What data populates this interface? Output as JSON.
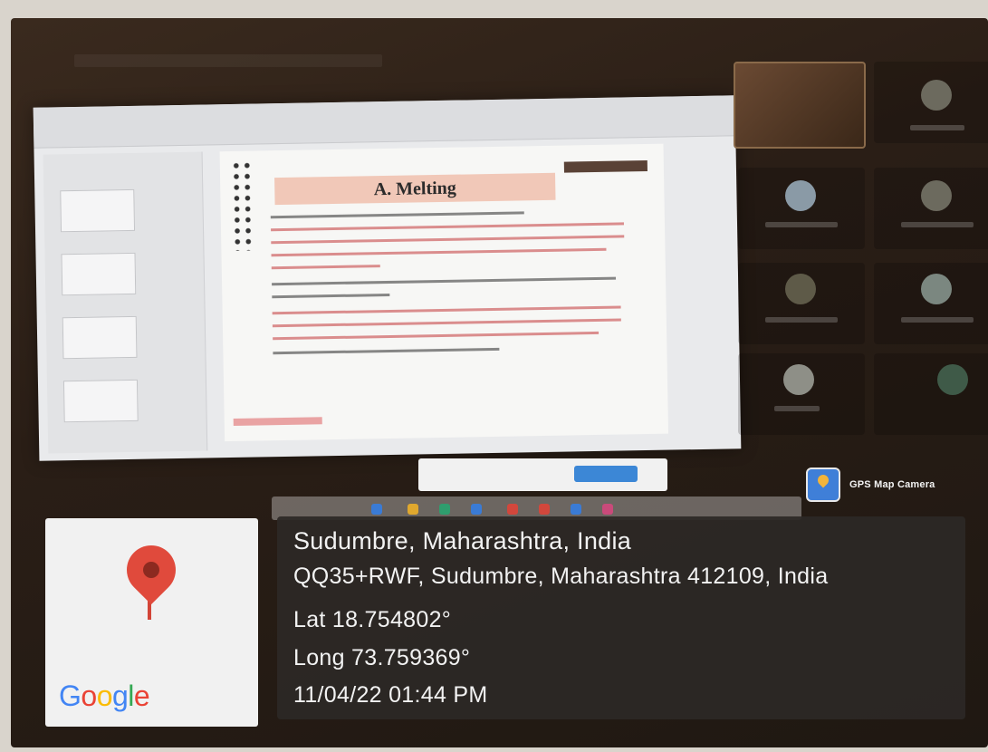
{
  "overlay": {
    "app_name": "GPS Map Camera",
    "location_title": "Sudumbre, Maharashtra, India",
    "address": "QQ35+RWF, Sudumbre, Maharashtra 412109, India",
    "latitude": "Lat 18.754802°",
    "longitude": "Long 73.759369°",
    "datetime": "11/04/22 01:44 PM"
  },
  "map_card": {
    "logo_letters": [
      "G",
      "o",
      "o",
      "g",
      "l",
      "e"
    ],
    "logo_colors": [
      "#4285F4",
      "#EA4335",
      "#FBBC05",
      "#4285F4",
      "#34A853",
      "#EA4335"
    ]
  },
  "slide": {
    "title": "A. Melting"
  },
  "colors": {
    "overlay_bg": "#2d2826",
    "pin": "#e04a3c",
    "gps_icon": "#3f7fd8"
  }
}
